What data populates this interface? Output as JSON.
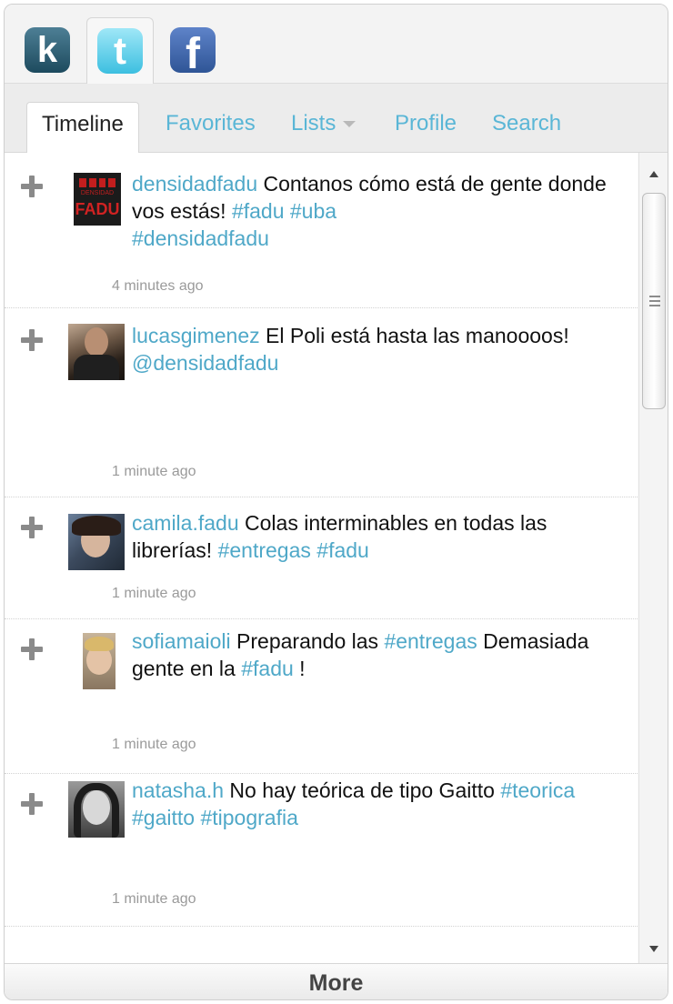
{
  "services": [
    {
      "name": "Klout",
      "glyph": "k"
    },
    {
      "name": "Twitter",
      "glyph": "t"
    },
    {
      "name": "Facebook",
      "glyph": "f"
    }
  ],
  "tabs": {
    "timeline": "Timeline",
    "favorites": "Favorites",
    "lists": "Lists",
    "profile": "Profile",
    "search": "Search"
  },
  "tweets": [
    {
      "user": "densidadfadu",
      "t1": "Contanos cómo está de gente donde vos  estás! ",
      "h1": "#fadu",
      "h2": "#uba",
      "h3": "#densidadfadu",
      "time": "4 minutes ago",
      "avatar_top": "DENSIDAD",
      "avatar_bottom": "FADU"
    },
    {
      "user": "lucasgimenez",
      "t1": "El Poli está hasta las manoooos! ",
      "h1": "@densidadfadu",
      "time": "1 minute ago"
    },
    {
      "user": "camila.fadu",
      "t1": "Colas interminables en todas las librerías! ",
      "h1": "#entregas",
      "h2": "#fadu",
      "time": "1 minute ago"
    },
    {
      "user": "sofiamaioli",
      "t1": "Preparando las ",
      "h1": "#entregas",
      "t2": " Demasiada gente en la ",
      "h2": "#fadu",
      "t3": " !",
      "time": "1 minute ago"
    },
    {
      "user": "natasha.h",
      "t1": "No hay teórica de tipo Gaitto  ",
      "h1": "#teorica",
      "h2": "#gaitto",
      "h3": "#tipografia",
      "time": "1 minute ago"
    }
  ],
  "more_label": "More",
  "colors": {
    "link": "#4fa8c8",
    "active_tab": "#222222",
    "tab": "#5ab6d6"
  }
}
